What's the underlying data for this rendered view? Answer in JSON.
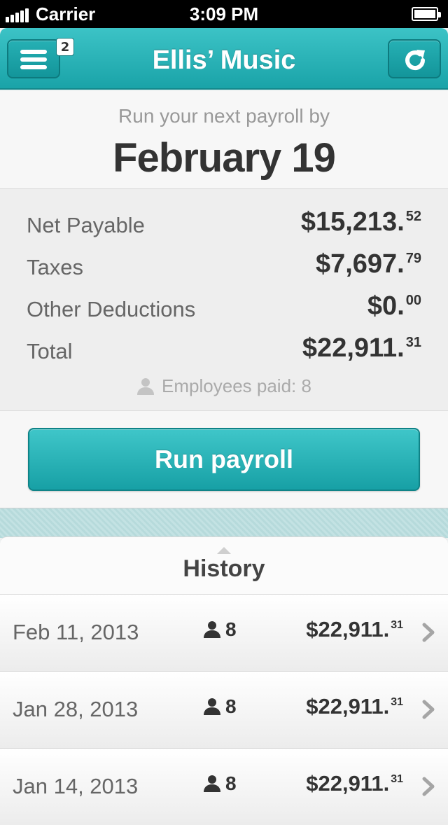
{
  "status_bar": {
    "carrier": "Carrier",
    "time": "3:09 PM"
  },
  "nav": {
    "title": "Ellis’ Music",
    "menu_badge": "2",
    "menu_icon": "hamburger-menu-icon",
    "refresh_icon": "refresh-icon"
  },
  "payroll": {
    "prompt": "Run your next payroll by",
    "due_date": "February 19",
    "rows": [
      {
        "label": "Net Payable",
        "amount": "$15,213.",
        "cents": "52"
      },
      {
        "label": "Taxes",
        "amount": "$7,697.",
        "cents": "79"
      },
      {
        "label": "Other Deductions",
        "amount": "$0.",
        "cents": "00"
      },
      {
        "label": "Total",
        "amount": "$22,911.",
        "cents": "31"
      }
    ],
    "employees_paid": "Employees paid: 8",
    "run_label": "Run payroll"
  },
  "history": {
    "title": "History",
    "items": [
      {
        "date": "Feb 11, 2013",
        "count": "8",
        "amount": "$22,911.",
        "cents": "31"
      },
      {
        "date": "Jan 28, 2013",
        "count": "8",
        "amount": "$22,911.",
        "cents": "31"
      },
      {
        "date": "Jan 14, 2013",
        "count": "8",
        "amount": "$22,911.",
        "cents": "31"
      }
    ]
  },
  "colors": {
    "accent": "#1fa8ad",
    "accent_dark": "#0f8387"
  }
}
